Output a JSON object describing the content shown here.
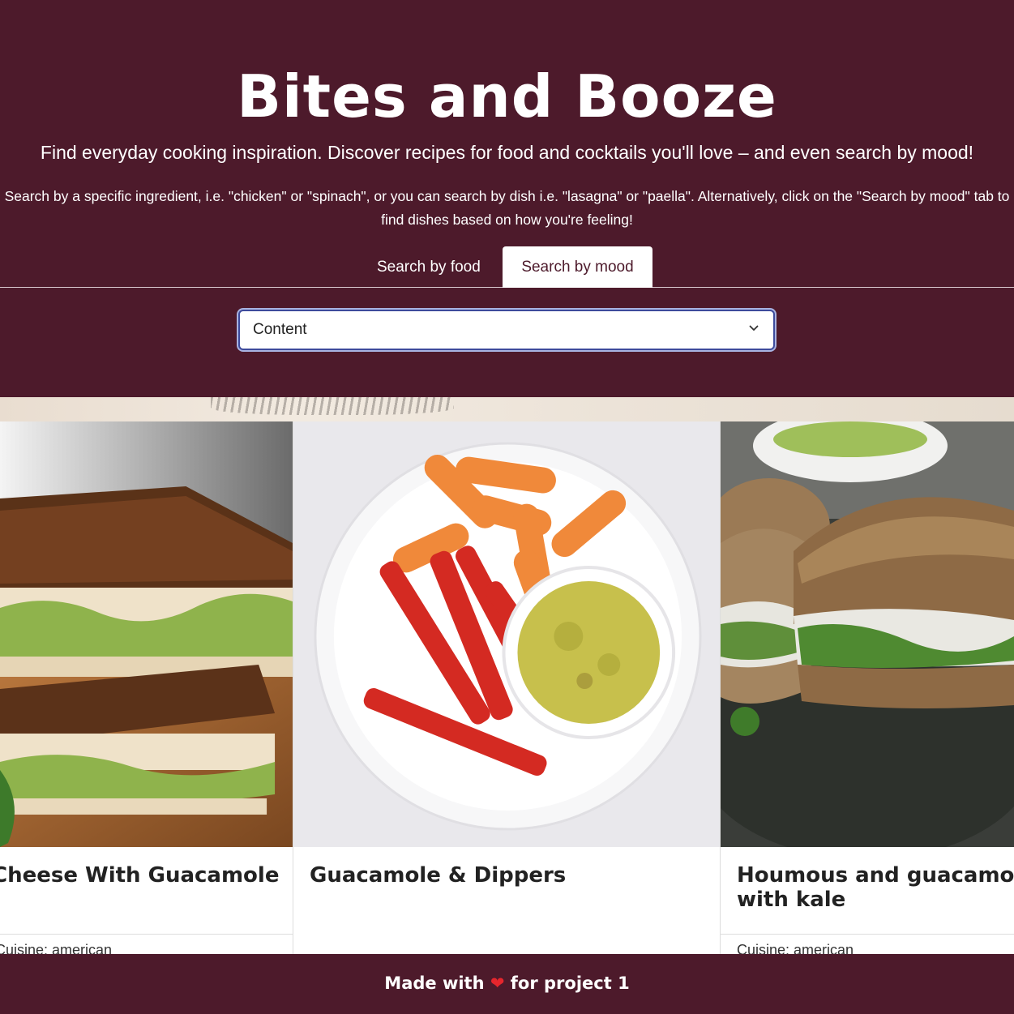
{
  "hero": {
    "title": "Bites and Booze",
    "tagline": "Find everyday cooking inspiration. Discover recipes for food and cocktails you'll love – and even search by mood!",
    "instructions": "Search by a specific ingredient, i.e. \"chicken\" or \"spinach\", or you can search by dish i.e. \"lasagna\" or \"paella\". Alternatively, click on the \"Search by mood\" tab to find dishes based on how you're feeling!"
  },
  "tabs": [
    {
      "label": "Search by food",
      "active": false
    },
    {
      "label": "Search by mood",
      "active": true
    }
  ],
  "mood_select": {
    "value": "Content",
    "icon": "chevron-down-icon"
  },
  "cards": [
    {
      "title": "Cheese With Guacamole",
      "meta": "Cuisine: american"
    },
    {
      "title": "Guacamole & Dippers",
      "meta": ""
    },
    {
      "title": "Houmous and guacamole with kale",
      "meta": "Cuisine: american"
    }
  ],
  "footer": {
    "text_before": "Made with",
    "heart": "❤",
    "text_after": "for project 1"
  },
  "colors": {
    "brand": "#4d1a2b",
    "focus_ring": "#3d4b9c",
    "heart": "#e5262d"
  }
}
